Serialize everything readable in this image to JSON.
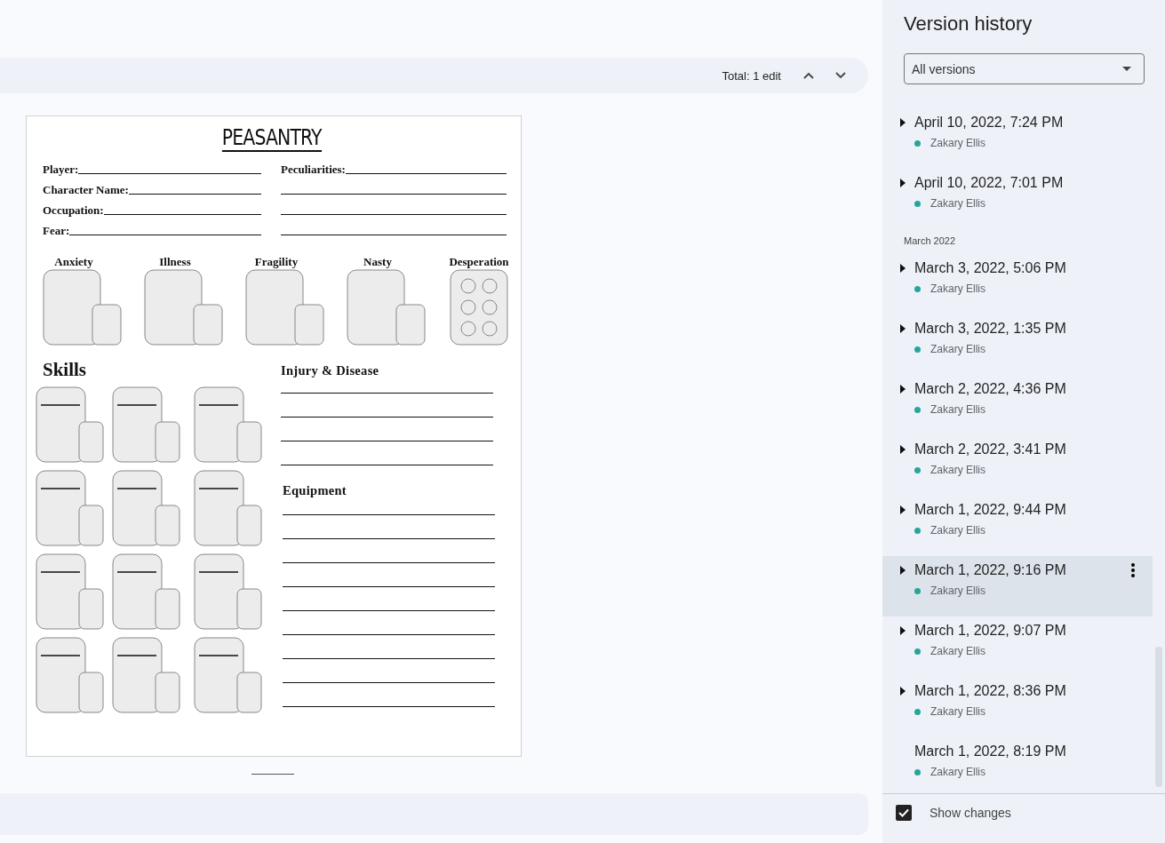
{
  "toolbar": {
    "total": "Total: 1 edit"
  },
  "document": {
    "title": "PEASANTRY",
    "fields": [
      {
        "label": "Player:"
      },
      {
        "label": "Character Name:"
      },
      {
        "label": "Occupation:"
      },
      {
        "label": "Fear:"
      }
    ],
    "peculiarities_label": "Peculiarities:",
    "stats": [
      {
        "label": "Anxiety",
        "kind": "tracker"
      },
      {
        "label": "Illness",
        "kind": "tracker"
      },
      {
        "label": "Fragility",
        "kind": "tracker"
      },
      {
        "label": "Nasty",
        "kind": "tracker"
      },
      {
        "label": "Desperation",
        "kind": "dots"
      }
    ],
    "skills_heading": "Skills",
    "injury_heading": "Injury & Disease",
    "equipment_heading": "Equipment"
  },
  "panel": {
    "title": "Version history",
    "filter": "All versions",
    "entries": [
      {
        "kind": "version",
        "date": "April 10, 2022, 7:24 PM",
        "author": "Zakary Ellis",
        "color": "#26a69a",
        "expandable": true,
        "selected": false
      },
      {
        "kind": "version",
        "date": "April 10, 2022, 7:01 PM",
        "author": "Zakary Ellis",
        "color": "#26a69a",
        "expandable": true,
        "selected": false
      },
      {
        "kind": "month",
        "label": "March 2022"
      },
      {
        "kind": "version",
        "date": "March 3, 2022, 5:06 PM",
        "author": "Zakary Ellis",
        "color": "#26a69a",
        "expandable": true,
        "selected": false
      },
      {
        "kind": "version",
        "date": "March 3, 2022, 1:35 PM",
        "author": "Zakary Ellis",
        "color": "#26a69a",
        "expandable": true,
        "selected": false
      },
      {
        "kind": "version",
        "date": "March 2, 2022, 4:36 PM",
        "author": "Zakary Ellis",
        "color": "#26a69a",
        "expandable": true,
        "selected": false
      },
      {
        "kind": "version",
        "date": "March 2, 2022, 3:41 PM",
        "author": "Zakary Ellis",
        "color": "#26a69a",
        "expandable": true,
        "selected": false
      },
      {
        "kind": "version",
        "date": "March 1, 2022, 9:44 PM",
        "author": "Zakary Ellis",
        "color": "#26a69a",
        "expandable": true,
        "selected": false
      },
      {
        "kind": "version",
        "date": "March 1, 2022, 9:16 PM",
        "author": "Zakary Ellis",
        "color": "#26a69a",
        "expandable": true,
        "selected": true
      },
      {
        "kind": "version",
        "date": "March 1, 2022, 9:07 PM",
        "author": "Zakary Ellis",
        "color": "#26a69a",
        "expandable": true,
        "selected": false
      },
      {
        "kind": "version",
        "date": "March 1, 2022, 8:36 PM",
        "author": "Zakary Ellis",
        "color": "#26a69a",
        "expandable": true,
        "selected": false
      },
      {
        "kind": "version",
        "date": "March 1, 2022, 8:19 PM",
        "author": "Zakary Ellis",
        "color": "#26a69a",
        "expandable": false,
        "selected": false
      }
    ],
    "show_changes": {
      "label": "Show changes",
      "checked": true
    }
  }
}
